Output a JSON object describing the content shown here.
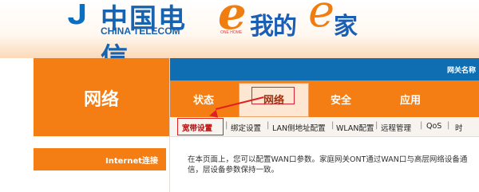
{
  "header": {
    "telecom_cn": "中国电信",
    "telecom_en": "CHINA TELECOM",
    "brand_e_sub": "ONE HOME",
    "brand_text": "我的",
    "brand_jia": "家",
    "brand_e": "e"
  },
  "sidebar": {
    "title": "网络",
    "items": [
      {
        "label": "Internet连接"
      }
    ]
  },
  "topbar": {
    "gateway_label": "网关名称"
  },
  "tabs": [
    {
      "label": "状态"
    },
    {
      "label": "网络",
      "active": true
    },
    {
      "label": "安全"
    },
    {
      "label": "应用"
    }
  ],
  "subnav": [
    {
      "label": "宽带设置",
      "active": true
    },
    {
      "label": "绑定设置"
    },
    {
      "label": "LAN侧地址配置"
    },
    {
      "label": "WLAN配置"
    },
    {
      "label": "远程管理"
    },
    {
      "label": "QoS"
    },
    {
      "label": "时"
    }
  ],
  "content": {
    "description": "在本页面上，您可以配置WAN口参数。家庭网关ONT通过WAN口与高层网络设备通信，层设备参数保持一致。"
  },
  "colors": {
    "orange": "#f47d14",
    "blue": "#0f6db2",
    "highlight": "#e02020"
  }
}
